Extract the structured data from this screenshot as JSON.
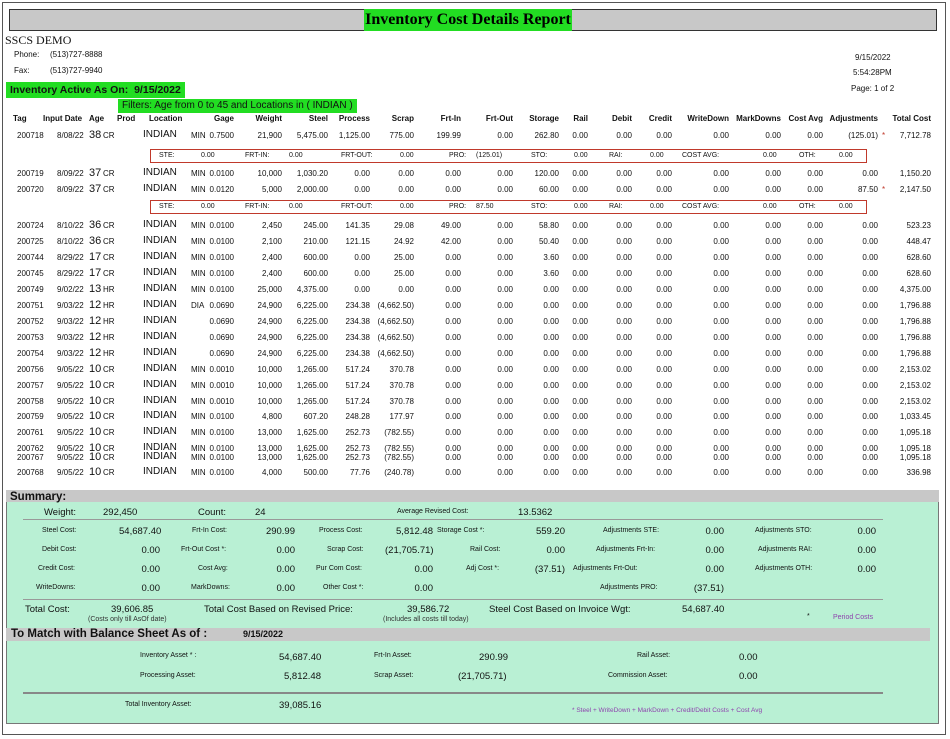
{
  "report": {
    "title": "Inventory Cost Details Report",
    "company": "SSCS DEMO",
    "phone_label": "Phone:",
    "phone": "(513)727-8888",
    "fax_label": "Fax:",
    "fax": "(513)727-9940",
    "date": "9/15/2022",
    "time": "5:54:28PM",
    "page": "Page: 1 of 2",
    "active_label": "Inventory Active As On:",
    "active_date": "9/15/2022",
    "filters": "Filters: Age from 0 to 45 and Locations in ( INDIAN )"
  },
  "columns": [
    "Tag",
    "Input Date",
    "Age",
    "Prod",
    "Location",
    "Gage",
    "Weight",
    "Steel",
    "Process",
    "Scrap",
    "Frt-In",
    "Frt-Out",
    "Storage",
    "Rail",
    "Debit",
    "Credit",
    "WriteDown",
    "MarkDowns",
    "Cost Avg",
    "Adjustments",
    "Total Cost"
  ],
  "rows": [
    {
      "tag": "200718",
      "date": "8/08/22",
      "age": "38",
      "prod": "CR",
      "loc": "INDIAN",
      "gtype": "MIN",
      "gage": "0.7500",
      "weight": "21,900",
      "steel": "5,475.00",
      "process": "1,125.00",
      "scrap": "775.00",
      "frtin": "199.99",
      "frtout": "0.00",
      "storage": "262.80",
      "rail": "0.00",
      "debit": "0.00",
      "credit": "0.00",
      "writedown": "0.00",
      "markdowns": "0.00",
      "costavg": "0.00",
      "adj": "(125.01)",
      "flag": "*",
      "total": "7,712.78"
    },
    {
      "tag": "200719",
      "date": "8/09/22",
      "age": "37",
      "prod": "CR",
      "loc": "INDIAN",
      "gtype": "MIN",
      "gage": "0.0100",
      "weight": "10,000",
      "steel": "1,030.20",
      "process": "0.00",
      "scrap": "0.00",
      "frtin": "0.00",
      "frtout": "0.00",
      "storage": "120.00",
      "rail": "0.00",
      "debit": "0.00",
      "credit": "0.00",
      "writedown": "0.00",
      "markdowns": "0.00",
      "costavg": "0.00",
      "adj": "0.00",
      "flag": "",
      "total": "1,150.20"
    },
    {
      "tag": "200720",
      "date": "8/09/22",
      "age": "37",
      "prod": "CR",
      "loc": "INDIAN",
      "gtype": "MIN",
      "gage": "0.0120",
      "weight": "5,000",
      "steel": "2,000.00",
      "process": "0.00",
      "scrap": "0.00",
      "frtin": "0.00",
      "frtout": "0.00",
      "storage": "60.00",
      "rail": "0.00",
      "debit": "0.00",
      "credit": "0.00",
      "writedown": "0.00",
      "markdowns": "0.00",
      "costavg": "0.00",
      "adj": "87.50",
      "flag": "*",
      "total": "2,147.50"
    },
    {
      "tag": "200724",
      "date": "8/10/22",
      "age": "36",
      "prod": "CR",
      "loc": "INDIAN",
      "gtype": "MIN",
      "gage": "0.0100",
      "weight": "2,450",
      "steel": "245.00",
      "process": "141.35",
      "scrap": "29.08",
      "frtin": "49.00",
      "frtout": "0.00",
      "storage": "58.80",
      "rail": "0.00",
      "debit": "0.00",
      "credit": "0.00",
      "writedown": "0.00",
      "markdowns": "0.00",
      "costavg": "0.00",
      "adj": "0.00",
      "flag": "",
      "total": "523.23"
    },
    {
      "tag": "200725",
      "date": "8/10/22",
      "age": "36",
      "prod": "CR",
      "loc": "INDIAN",
      "gtype": "MIN",
      "gage": "0.0100",
      "weight": "2,100",
      "steel": "210.00",
      "process": "121.15",
      "scrap": "24.92",
      "frtin": "42.00",
      "frtout": "0.00",
      "storage": "50.40",
      "rail": "0.00",
      "debit": "0.00",
      "credit": "0.00",
      "writedown": "0.00",
      "markdowns": "0.00",
      "costavg": "0.00",
      "adj": "0.00",
      "flag": "",
      "total": "448.47"
    },
    {
      "tag": "200744",
      "date": "8/29/22",
      "age": "17",
      "prod": "CR",
      "loc": "INDIAN",
      "gtype": "MIN",
      "gage": "0.0100",
      "weight": "2,400",
      "steel": "600.00",
      "process": "0.00",
      "scrap": "25.00",
      "frtin": "0.00",
      "frtout": "0.00",
      "storage": "3.60",
      "rail": "0.00",
      "debit": "0.00",
      "credit": "0.00",
      "writedown": "0.00",
      "markdowns": "0.00",
      "costavg": "0.00",
      "adj": "0.00",
      "flag": "",
      "total": "628.60"
    },
    {
      "tag": "200745",
      "date": "8/29/22",
      "age": "17",
      "prod": "CR",
      "loc": "INDIAN",
      "gtype": "MIN",
      "gage": "0.0100",
      "weight": "2,400",
      "steel": "600.00",
      "process": "0.00",
      "scrap": "25.00",
      "frtin": "0.00",
      "frtout": "0.00",
      "storage": "3.60",
      "rail": "0.00",
      "debit": "0.00",
      "credit": "0.00",
      "writedown": "0.00",
      "markdowns": "0.00",
      "costavg": "0.00",
      "adj": "0.00",
      "flag": "",
      "total": "628.60"
    },
    {
      "tag": "200749",
      "date": "9/02/22",
      "age": "13",
      "prod": "HR",
      "loc": "INDIAN",
      "gtype": "MIN",
      "gage": "0.0100",
      "weight": "25,000",
      "steel": "4,375.00",
      "process": "0.00",
      "scrap": "0.00",
      "frtin": "0.00",
      "frtout": "0.00",
      "storage": "0.00",
      "rail": "0.00",
      "debit": "0.00",
      "credit": "0.00",
      "writedown": "0.00",
      "markdowns": "0.00",
      "costavg": "0.00",
      "adj": "0.00",
      "flag": "",
      "total": "4,375.00"
    },
    {
      "tag": "200751",
      "date": "9/03/22",
      "age": "12",
      "prod": "HR",
      "loc": "INDIAN",
      "gtype": "DIA",
      "gage": "0.0690",
      "weight": "24,900",
      "steel": "6,225.00",
      "process": "234.38",
      "scrap": "(4,662.50)",
      "frtin": "0.00",
      "frtout": "0.00",
      "storage": "0.00",
      "rail": "0.00",
      "debit": "0.00",
      "credit": "0.00",
      "writedown": "0.00",
      "markdowns": "0.00",
      "costavg": "0.00",
      "adj": "0.00",
      "flag": "",
      "total": "1,796.88"
    },
    {
      "tag": "200752",
      "date": "9/03/22",
      "age": "12",
      "prod": "HR",
      "loc": "INDIAN",
      "gtype": "",
      "gage": "0.0690",
      "weight": "24,900",
      "steel": "6,225.00",
      "process": "234.38",
      "scrap": "(4,662.50)",
      "frtin": "0.00",
      "frtout": "0.00",
      "storage": "0.00",
      "rail": "0.00",
      "debit": "0.00",
      "credit": "0.00",
      "writedown": "0.00",
      "markdowns": "0.00",
      "costavg": "0.00",
      "adj": "0.00",
      "flag": "",
      "total": "1,796.88"
    },
    {
      "tag": "200753",
      "date": "9/03/22",
      "age": "12",
      "prod": "HR",
      "loc": "INDIAN",
      "gtype": "",
      "gage": "0.0690",
      "weight": "24,900",
      "steel": "6,225.00",
      "process": "234.38",
      "scrap": "(4,662.50)",
      "frtin": "0.00",
      "frtout": "0.00",
      "storage": "0.00",
      "rail": "0.00",
      "debit": "0.00",
      "credit": "0.00",
      "writedown": "0.00",
      "markdowns": "0.00",
      "costavg": "0.00",
      "adj": "0.00",
      "flag": "",
      "total": "1,796.88"
    },
    {
      "tag": "200754",
      "date": "9/03/22",
      "age": "12",
      "prod": "HR",
      "loc": "INDIAN",
      "gtype": "",
      "gage": "0.0690",
      "weight": "24,900",
      "steel": "6,225.00",
      "process": "234.38",
      "scrap": "(4,662.50)",
      "frtin": "0.00",
      "frtout": "0.00",
      "storage": "0.00",
      "rail": "0.00",
      "debit": "0.00",
      "credit": "0.00",
      "writedown": "0.00",
      "markdowns": "0.00",
      "costavg": "0.00",
      "adj": "0.00",
      "flag": "",
      "total": "1,796.88"
    },
    {
      "tag": "200756",
      "date": "9/05/22",
      "age": "10",
      "prod": "CR",
      "loc": "INDIAN",
      "gtype": "MIN",
      "gage": "0.0010",
      "weight": "10,000",
      "steel": "1,265.00",
      "process": "517.24",
      "scrap": "370.78",
      "frtin": "0.00",
      "frtout": "0.00",
      "storage": "0.00",
      "rail": "0.00",
      "debit": "0.00",
      "credit": "0.00",
      "writedown": "0.00",
      "markdowns": "0.00",
      "costavg": "0.00",
      "adj": "0.00",
      "flag": "",
      "total": "2,153.02"
    },
    {
      "tag": "200757",
      "date": "9/05/22",
      "age": "10",
      "prod": "CR",
      "loc": "INDIAN",
      "gtype": "MIN",
      "gage": "0.0010",
      "weight": "10,000",
      "steel": "1,265.00",
      "process": "517.24",
      "scrap": "370.78",
      "frtin": "0.00",
      "frtout": "0.00",
      "storage": "0.00",
      "rail": "0.00",
      "debit": "0.00",
      "credit": "0.00",
      "writedown": "0.00",
      "markdowns": "0.00",
      "costavg": "0.00",
      "adj": "0.00",
      "flag": "",
      "total": "2,153.02"
    },
    {
      "tag": "200758",
      "date": "9/05/22",
      "age": "10",
      "prod": "CR",
      "loc": "INDIAN",
      "gtype": "MIN",
      "gage": "0.0010",
      "weight": "10,000",
      "steel": "1,265.00",
      "process": "517.24",
      "scrap": "370.78",
      "frtin": "0.00",
      "frtout": "0.00",
      "storage": "0.00",
      "rail": "0.00",
      "debit": "0.00",
      "credit": "0.00",
      "writedown": "0.00",
      "markdowns": "0.00",
      "costavg": "0.00",
      "adj": "0.00",
      "flag": "",
      "total": "2,153.02"
    },
    {
      "tag": "200759",
      "date": "9/05/22",
      "age": "10",
      "prod": "CR",
      "loc": "INDIAN",
      "gtype": "MIN",
      "gage": "0.0100",
      "weight": "4,800",
      "steel": "607.20",
      "process": "248.28",
      "scrap": "177.97",
      "frtin": "0.00",
      "frtout": "0.00",
      "storage": "0.00",
      "rail": "0.00",
      "debit": "0.00",
      "credit": "0.00",
      "writedown": "0.00",
      "markdowns": "0.00",
      "costavg": "0.00",
      "adj": "0.00",
      "flag": "",
      "total": "1,033.45"
    },
    {
      "tag": "200761",
      "date": "9/05/22",
      "age": "10",
      "prod": "CR",
      "loc": "INDIAN",
      "gtype": "MIN",
      "gage": "0.0100",
      "weight": "13,000",
      "steel": "1,625.00",
      "process": "252.73",
      "scrap": "(782.55)",
      "frtin": "0.00",
      "frtout": "0.00",
      "storage": "0.00",
      "rail": "0.00",
      "debit": "0.00",
      "credit": "0.00",
      "writedown": "0.00",
      "markdowns": "0.00",
      "costavg": "0.00",
      "adj": "0.00",
      "flag": "",
      "total": "1,095.18"
    },
    {
      "tag": "200762",
      "date": "9/05/22",
      "age": "10",
      "prod": "CR",
      "loc": "INDIAN",
      "gtype": "MIN",
      "gage": "0.0100",
      "weight": "13,000",
      "steel": "1,625.00",
      "process": "252.73",
      "scrap": "(782.55)",
      "frtin": "0.00",
      "frtout": "0.00",
      "storage": "0.00",
      "rail": "0.00",
      "debit": "0.00",
      "credit": "0.00",
      "writedown": "0.00",
      "markdowns": "0.00",
      "costavg": "0.00",
      "adj": "0.00",
      "flag": "",
      "total": "1,095.18"
    },
    {
      "tag": "200767",
      "date": "9/05/22",
      "age": "10",
      "prod": "CR",
      "loc": "INDIAN",
      "gtype": "MIN",
      "gage": "0.0100",
      "weight": "13,000",
      "steel": "1,625.00",
      "process": "252.73",
      "scrap": "(782.55)",
      "frtin": "0.00",
      "frtout": "0.00",
      "storage": "0.00",
      "rail": "0.00",
      "debit": "0.00",
      "credit": "0.00",
      "writedown": "0.00",
      "markdowns": "0.00",
      "costavg": "0.00",
      "adj": "0.00",
      "flag": "",
      "total": "1,095.18"
    },
    {
      "tag": "200768",
      "date": "9/05/22",
      "age": "10",
      "prod": "CR",
      "loc": "INDIAN",
      "gtype": "MIN",
      "gage": "0.0100",
      "weight": "4,000",
      "steel": "500.00",
      "process": "77.76",
      "scrap": "(240.78)",
      "frtin": "0.00",
      "frtout": "0.00",
      "storage": "0.00",
      "rail": "0.00",
      "debit": "0.00",
      "credit": "0.00",
      "writedown": "0.00",
      "markdowns": "0.00",
      "costavg": "0.00",
      "adj": "0.00",
      "flag": "",
      "total": "336.98"
    }
  ],
  "adjust_details": [
    {
      "ste_l": "STE:",
      "ste": "0.00",
      "frtin_l": "FRT-IN:",
      "frtin": "0.00",
      "frtout_l": "FRT-OUT:",
      "frtout": "0.00",
      "pro_l": "PRO:",
      "pro": "(125.01)",
      "sto_l": "STO:",
      "sto": "0.00",
      "rai_l": "RAI:",
      "rai": "0.00",
      "ca_l": "COST AVG:",
      "ca": "0.00",
      "oth_l": "OTH:",
      "oth": "0.00"
    },
    {
      "ste_l": "STE:",
      "ste": "0.00",
      "frtin_l": "FRT-IN:",
      "frtin": "0.00",
      "frtout_l": "FRT-OUT:",
      "frtout": "0.00",
      "pro_l": "PRO:",
      "pro": "87.50",
      "sto_l": "STO:",
      "sto": "0.00",
      "rai_l": "RAI:",
      "rai": "0.00",
      "ca_l": "COST AVG:",
      "ca": "0.00",
      "oth_l": "OTH:",
      "oth": "0.00"
    }
  ],
  "summary": {
    "title": "Summary:",
    "weight_l": "Weight:",
    "weight": "292,450",
    "count_l": "Count:",
    "count": "24",
    "avgrev_l": "Average Revised Cost:",
    "avgrev": "13.5362",
    "steel_l": "Steel Cost:",
    "steel": "54,687.40",
    "frtin_l": "Frt-In Cost:",
    "frtin": "290.99",
    "process_l": "Process Cost:",
    "process": "5,812.48",
    "storage_l": "Storage Cost *:",
    "storage": "559.20",
    "adjste_l": "Adjustments STE:",
    "adjste": "0.00",
    "adjsto_l": "Adjustments STO:",
    "adjsto": "0.00",
    "debit_l": "Debit Cost:",
    "debit": "0.00",
    "frtout_l": "Frt-Out Cost *:",
    "frtout": "0.00",
    "scrap_l": "Scrap Cost:",
    "scrap": "(21,705.71)",
    "rail_l": "Rail Cost:",
    "rail": "0.00",
    "adjfrtin_l": "Adjustments Frt-In:",
    "adjfrtin": "0.00",
    "adjrai_l": "Adjustments RAI:",
    "adjrai": "0.00",
    "credit_l": "Credit Cost:",
    "credit": "0.00",
    "costavg_l": "Cost Avg:",
    "costavg": "0.00",
    "purcom_l": "Pur Com Cost:",
    "purcom": "0.00",
    "adj_l": "Adj Cost *:",
    "adj": "(37.51)",
    "adjfrtout_l": "Adjustments Frt-Out:",
    "adjfrtout": "0.00",
    "adjoth_l": "Adjustments OTH:",
    "adjoth": "0.00",
    "writedowns_l": "WriteDowns:",
    "writedowns": "0.00",
    "markdowns_l": "MarkDowns:",
    "markdowns": "0.00",
    "other_l": "Other Cost *:",
    "other": "0.00",
    "adjpro_l": "Adjustments PRO:",
    "adjpro": "(37.51)",
    "total_l": "Total Cost:",
    "total": "39,606.85",
    "total_note": "(Costs only till AsOf date)",
    "revised_l": "Total Cost Based on Revised Price:",
    "revised": "39,586.72",
    "revised_note": "(Includes all costs till today)",
    "invoice_l": "Steel Cost Based on Invoice Wgt:",
    "invoice": "54,687.40",
    "period_note": "Period Costs",
    "star": "*"
  },
  "balance": {
    "title": "To Match with Balance Sheet As of :",
    "date": "9/15/2022",
    "inv_l": "Inventory Asset * :",
    "inv": "54,687.40",
    "frtin_l": "Frt-In Asset:",
    "frtin": "290.99",
    "rail_l": "Rail Asset:",
    "rail": "0.00",
    "proc_l": "Processing Asset:",
    "proc": "5,812.48",
    "scrap_l": "Scrap Asset:",
    "scrap": "(21,705.71)",
    "comm_l": "Commission Asset:",
    "comm": "0.00",
    "total_l": "Total Inventory Asset:",
    "total": "39,085.16",
    "footnote": "* Steel + WriteDown + MarkDown + Credit/Debit Costs + Cost Avg"
  }
}
